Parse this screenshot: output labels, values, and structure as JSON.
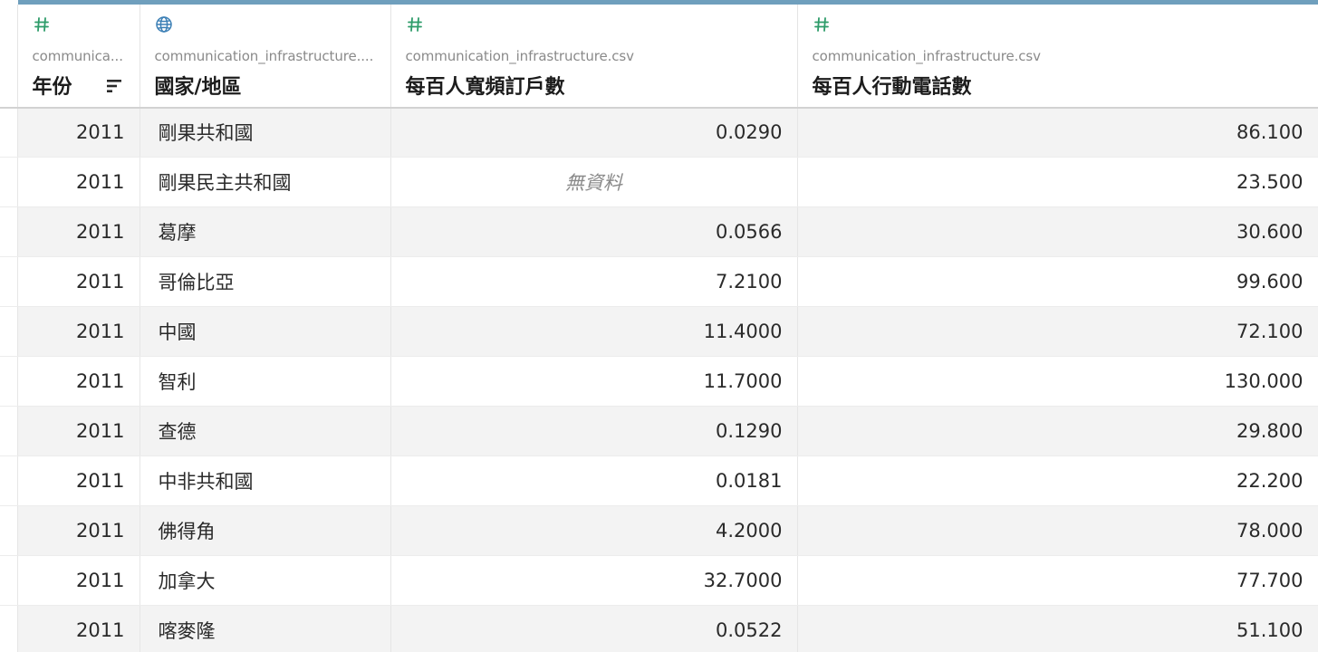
{
  "columns": [
    {
      "type_icon": "number-hash-icon",
      "source": "communica...",
      "name": "年份",
      "sorted": true,
      "align": "right"
    },
    {
      "type_icon": "globe-icon",
      "source": "communication_infrastructure....",
      "name": "國家/地區",
      "align": "left"
    },
    {
      "type_icon": "number-hash-icon",
      "source": "communication_infrastructure.csv",
      "name": "每百人寬頻訂戶數",
      "align": "right"
    },
    {
      "type_icon": "number-hash-icon",
      "source": "communication_infrastructure.csv",
      "name": "每百人行動電話數",
      "align": "right"
    }
  ],
  "null_label": "無資料",
  "rows": [
    [
      "2011",
      "剛果共和國",
      "0.0290",
      "86.100"
    ],
    [
      "2011",
      "剛果民主共和國",
      null,
      "23.500"
    ],
    [
      "2011",
      "葛摩",
      "0.0566",
      "30.600"
    ],
    [
      "2011",
      "哥倫比亞",
      "7.2100",
      "99.600"
    ],
    [
      "2011",
      "中國",
      "11.4000",
      "72.100"
    ],
    [
      "2011",
      "智利",
      "11.7000",
      "130.000"
    ],
    [
      "2011",
      "查德",
      "0.1290",
      "29.800"
    ],
    [
      "2011",
      "中非共和國",
      "0.0181",
      "22.200"
    ],
    [
      "2011",
      "佛得角",
      "4.2000",
      "78.000"
    ],
    [
      "2011",
      "加拿大",
      "32.7000",
      "77.700"
    ],
    [
      "2011",
      "喀麥隆",
      "0.0522",
      "51.100"
    ]
  ],
  "colors": {
    "accent_bar": "#6f9fbd",
    "number_icon": "#2e9c6a",
    "globe_icon": "#3b7fb5"
  }
}
